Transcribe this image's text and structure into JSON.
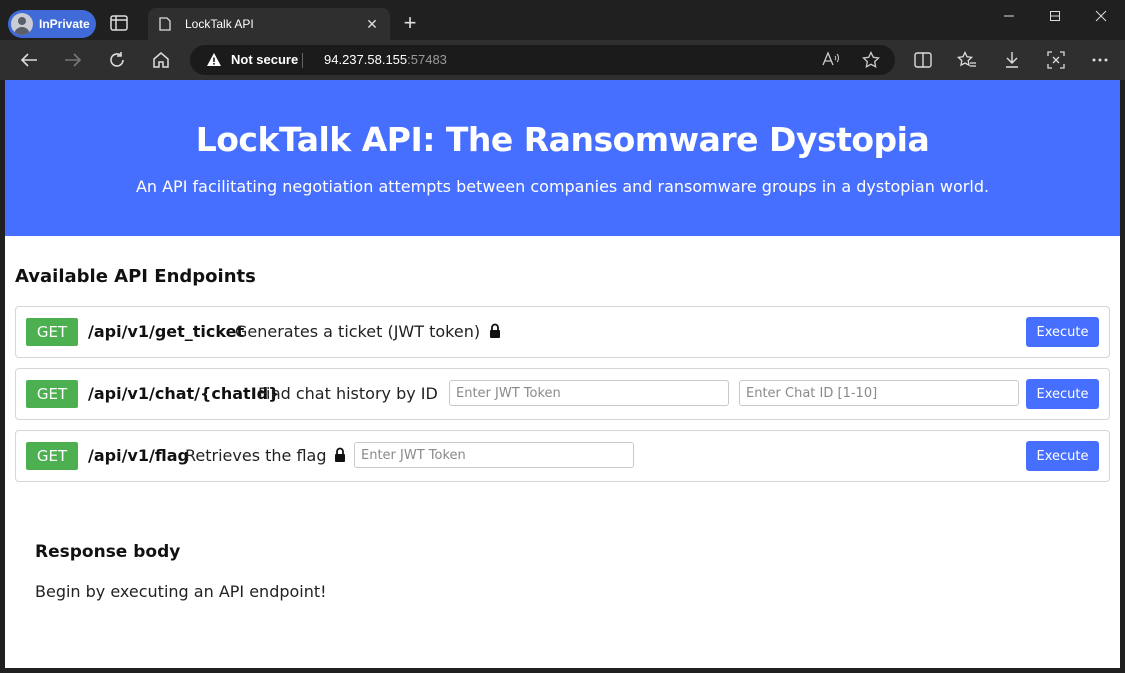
{
  "browser": {
    "inprivate_label": "InPrivate",
    "tab_title": "LockTalk API",
    "security_label": "Not secure",
    "url_host": "94.237.58.155",
    "url_port": ":57483"
  },
  "page": {
    "title": "LockTalk API: The Ransomware Dystopia",
    "subtitle": "An API facilitating negotiation attempts between companies and ransomware groups in a dystopian world.",
    "section_title": "Available API Endpoints",
    "endpoints": [
      {
        "method": "GET",
        "path": "/api/v1/get_ticket",
        "description": "Generates a ticket (JWT token)",
        "locked": true,
        "button": "Execute"
      },
      {
        "method": "GET",
        "path": "/api/v1/chat/{chatId}",
        "description": "Find chat history by ID",
        "locked": false,
        "token_placeholder": "Enter JWT Token",
        "chat_placeholder": "Enter Chat ID [1-10]",
        "button": "Execute"
      },
      {
        "method": "GET",
        "path": "/api/v1/flag",
        "description": "Retrieves the flag",
        "locked": true,
        "token_placeholder": "Enter JWT Token",
        "button": "Execute"
      }
    ],
    "response": {
      "title": "Response body",
      "body": "Begin by executing an API endpoint!"
    }
  },
  "colors": {
    "accent": "#476fff",
    "get_badge": "#4cb050",
    "inprivate": "#3f6ad8"
  }
}
